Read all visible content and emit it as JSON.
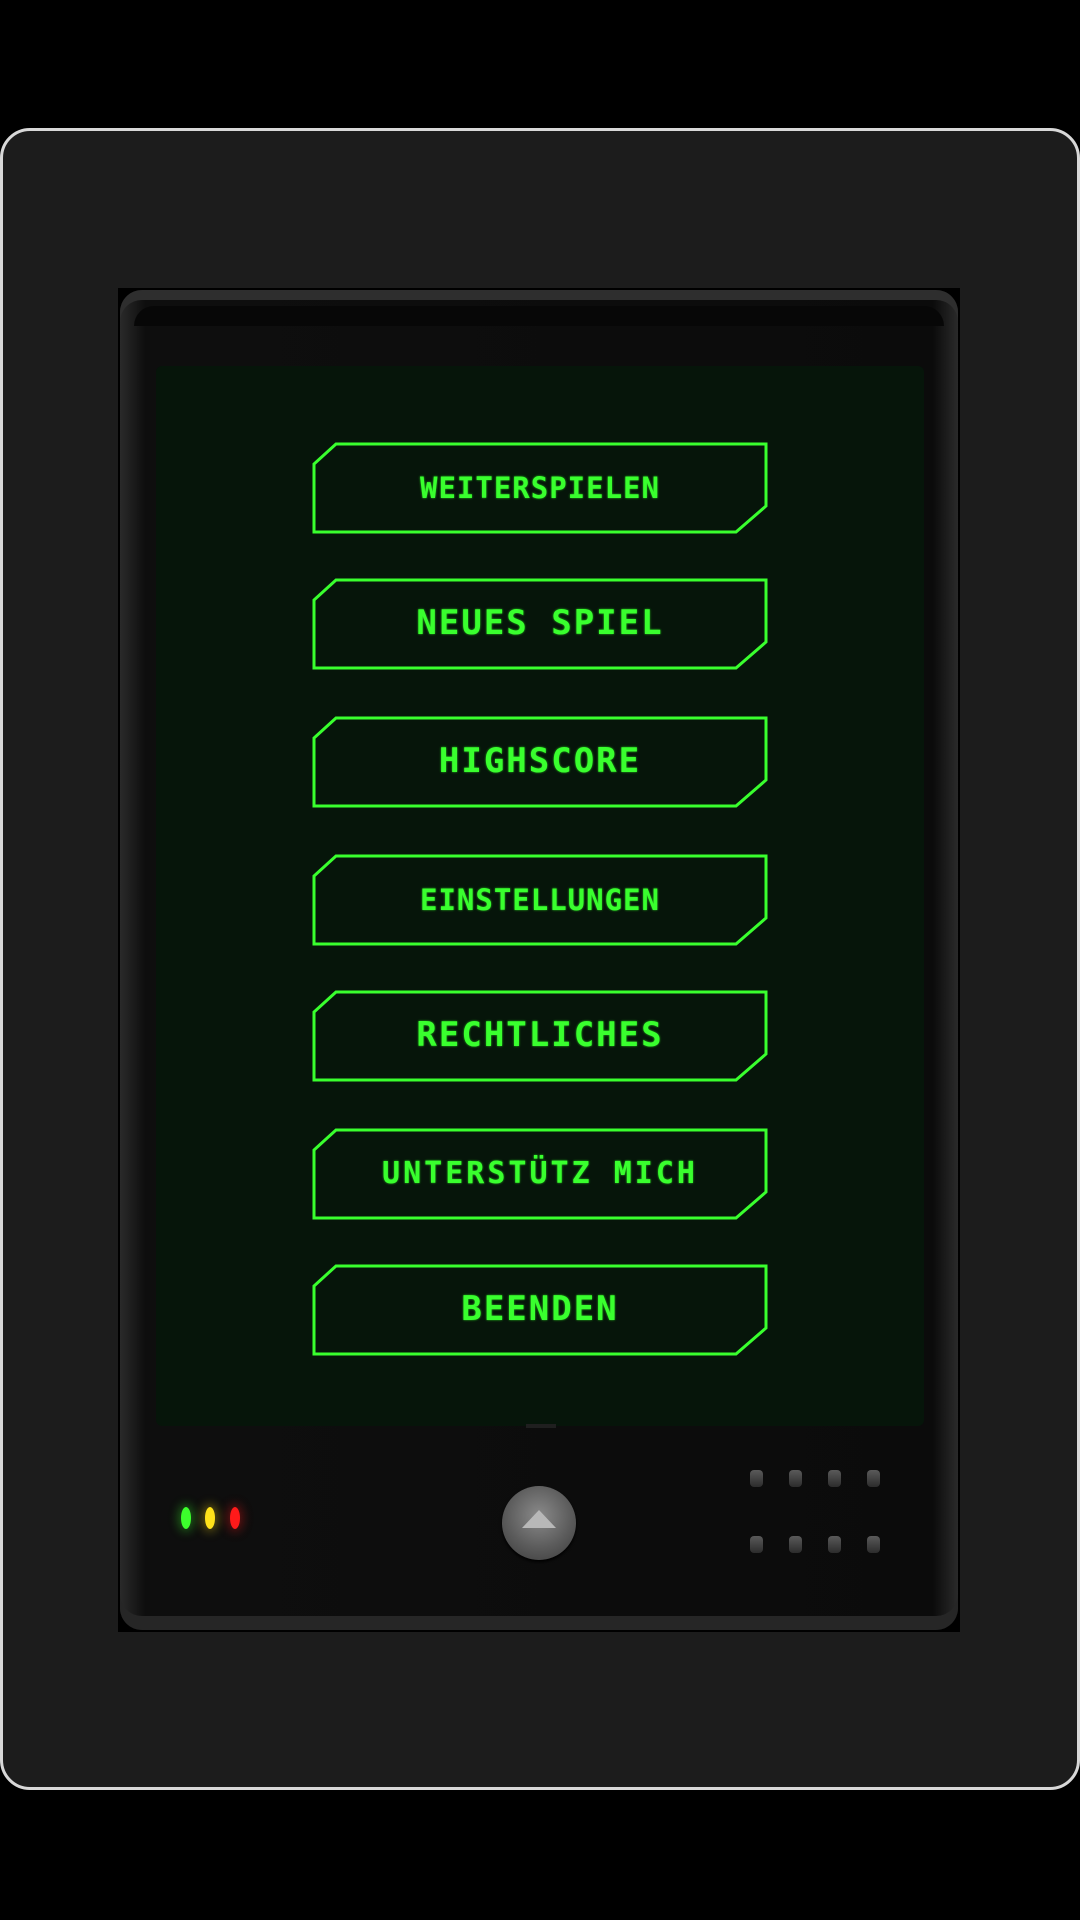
{
  "menu": {
    "items": [
      {
        "id": "weiterspielen",
        "label": "Weiterspielen"
      },
      {
        "id": "neues-spiel",
        "label": "Neues Spiel"
      },
      {
        "id": "highscore",
        "label": "Highscore"
      },
      {
        "id": "einstellungen",
        "label": "Einstellungen"
      },
      {
        "id": "rechtliches",
        "label": "Rechtliches"
      },
      {
        "id": "unterstuetz-mich",
        "label": "Unterstütz mich"
      },
      {
        "id": "beenden",
        "label": "Beenden"
      }
    ]
  },
  "device": {
    "leds": [
      "green",
      "yellow",
      "red"
    ],
    "home_button_icon": "chevron-up-icon",
    "speaker_holes": 8
  },
  "colors": {
    "accent": "#39ff2e",
    "screen": "#06150a",
    "frame": "#1c1c1c",
    "frame_border": "#d8d8d8",
    "led_green": "#3cff2c",
    "led_yellow": "#ffe21a",
    "led_red": "#ff1a1a"
  }
}
